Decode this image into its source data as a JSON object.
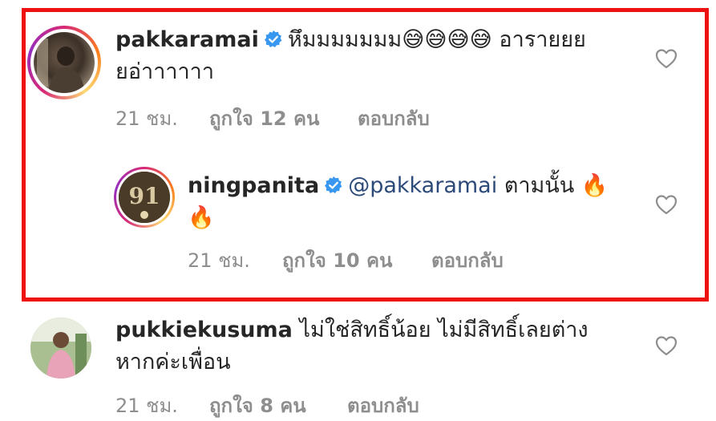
{
  "comments": [
    {
      "username": "pakkaramai",
      "text_line1": "หึมมมมมมม😅😅😅😅 อารายยย",
      "text_line2": "ยอ่าาาาาา",
      "time": "21 ชม.",
      "likes": "ถูกใจ 12 คน",
      "reply": "ตอบกลับ"
    },
    {
      "username": "ningpanita",
      "mention": "@pakkaramai",
      "text_line1": "ตามนั้น 🔥",
      "text_line2": "🔥",
      "time": "21 ชม.",
      "likes": "ถูกใจ 10 คน",
      "reply": "ตอบกลับ"
    },
    {
      "username": "pukkiekusuma",
      "text_line1": "ไม่ใช่สิทธิ์น้อย ไม่มีสิทธิ์เลยต่าง",
      "text_line2": "หากค่ะเพื่อน",
      "time": "21 ชม.",
      "likes": "ถูกใจ 8 คน",
      "reply": "ตอบกลับ"
    }
  ],
  "avatar_badge": "91",
  "colors": {
    "highlight_border": "#ee1111",
    "verified": "#3897f0",
    "meta_text": "#8e8e8e",
    "mention": "#2b4a7a"
  },
  "icons": [
    "verified-badge-icon",
    "heart-icon"
  ]
}
